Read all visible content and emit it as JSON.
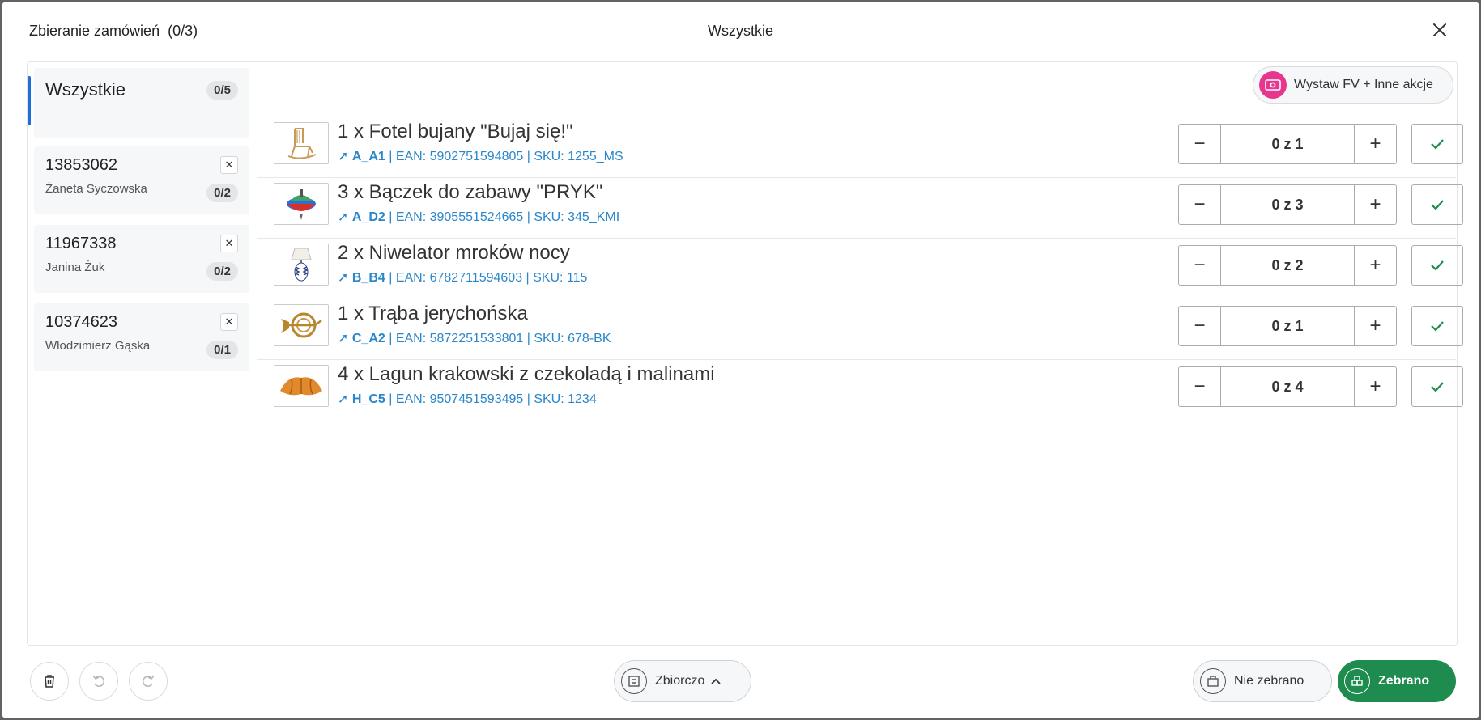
{
  "header": {
    "title": "Zbieranie zamówień",
    "count": "(0/3)",
    "center_title": "Wszystkie"
  },
  "sidebar": {
    "all": {
      "label": "Wszystkie",
      "badge": "0/5"
    },
    "orders": [
      {
        "number": "13853062",
        "customer": "Żaneta Syczowska",
        "badge": "0/2"
      },
      {
        "number": "11967338",
        "customer": "Janina Żuk",
        "badge": "0/2"
      },
      {
        "number": "10374623",
        "customer": "Włodzimierz Gąska",
        "badge": "0/1"
      }
    ]
  },
  "actions": {
    "invoice_button": "Wystaw FV + Inne akcje"
  },
  "products": [
    {
      "name": "1 x Fotel bujany \"Bujaj się!\"",
      "location": "A_A1",
      "details": " | EAN: 5902751594805 | SKU: 1255_MS",
      "qty": "0 z 1",
      "image": "rocking-chair"
    },
    {
      "name": "3 x Bączek do zabawy \"PRYK\"",
      "location": "A_D2",
      "details": " | EAN: 3905551524665 | SKU: 345_KMI",
      "qty": "0 z 3",
      "image": "spinning-top"
    },
    {
      "name": "2 x Niwelator mroków nocy",
      "location": "B_B4",
      "details": " | EAN: 6782711594603 | SKU: 115",
      "qty": "0 z 2",
      "image": "lamp"
    },
    {
      "name": "1 x Trąba jerychońska",
      "location": "C_A2",
      "details": " | EAN: 5872251533801 | SKU: 678-BK",
      "qty": "0 z 1",
      "image": "horn"
    },
    {
      "name": "4 x Lagun krakowski z czekoladą i malinami",
      "location": "H_C5",
      "details": " | EAN: 9507451593495 | SKU: 1234",
      "qty": "0 z 4",
      "image": "croissant"
    }
  ],
  "footer": {
    "summary_label": "Zbiorczo",
    "not_collected_label": "Nie zebrano",
    "collected_label": "Zebrano"
  },
  "colors": {
    "accent_blue": "#1e6fd9",
    "link_blue": "#2a86c9",
    "success_green": "#1e8c4e",
    "pink": "#e8368f"
  }
}
